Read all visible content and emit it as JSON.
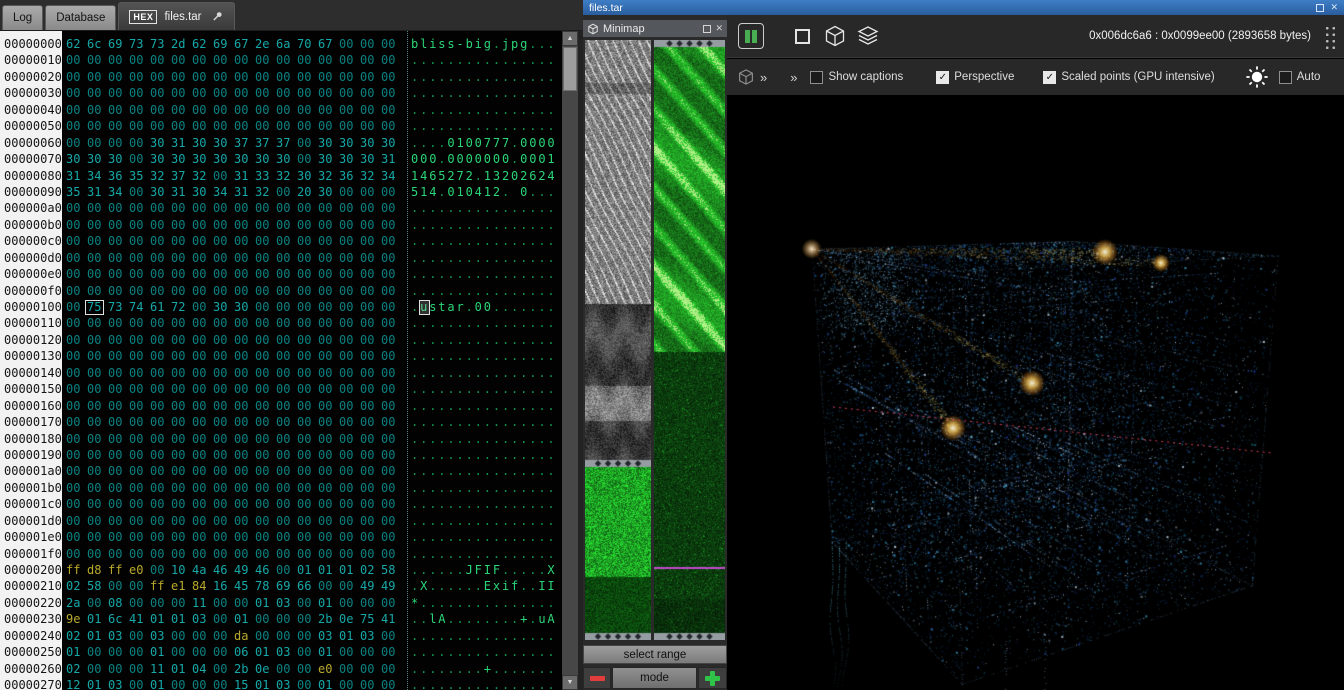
{
  "glyphs": {
    "up": "▲",
    "down": "▼",
    "close": "✕",
    "chevron": "»",
    "check": "✓"
  },
  "colors": {
    "titlebar_blue": "#316fb4",
    "hex_zero": "#0c8282",
    "hex_low": "#17a8a8",
    "hex_high": "#b9a92c",
    "ascii_printable": "#2bd677",
    "ascii_dim": "#0f9b52",
    "minimap_green": "#2fbf3f",
    "minimap_magenta": "#cd4bd7",
    "streak_orange": "#ffb347",
    "points_blue": "#3a7fd0",
    "accent_red": "#e23c3c",
    "accent_green": "#2fc34a"
  },
  "tabs": {
    "items": [
      {
        "label": "Log",
        "active": false
      },
      {
        "label": "Database",
        "active": false
      },
      {
        "label": "files.tar",
        "badge": "HEX",
        "active": true,
        "pinned": true
      }
    ]
  },
  "hex": {
    "cursor": {
      "row": 16,
      "col": 1
    },
    "rows": [
      {
        "addr": "00000000",
        "bytes": "62 6c 69 73 73 2d 62 69 67 2e 6a 70 67 00 00 00",
        "ascii": "bliss-big.jpg..."
      },
      {
        "addr": "00000010",
        "bytes": "00 00 00 00 00 00 00 00 00 00 00 00 00 00 00 00",
        "ascii": "................"
      },
      {
        "addr": "00000020",
        "bytes": "00 00 00 00 00 00 00 00 00 00 00 00 00 00 00 00",
        "ascii": "................"
      },
      {
        "addr": "00000030",
        "bytes": "00 00 00 00 00 00 00 00 00 00 00 00 00 00 00 00",
        "ascii": "................"
      },
      {
        "addr": "00000040",
        "bytes": "00 00 00 00 00 00 00 00 00 00 00 00 00 00 00 00",
        "ascii": "................"
      },
      {
        "addr": "00000050",
        "bytes": "00 00 00 00 00 00 00 00 00 00 00 00 00 00 00 00",
        "ascii": "................"
      },
      {
        "addr": "00000060",
        "bytes": "00 00 00 00 30 31 30 30 37 37 37 00 30 30 30 30",
        "ascii": "....0100777.0000"
      },
      {
        "addr": "00000070",
        "bytes": "30 30 30 00 30 30 30 30 30 30 30 00 30 30 30 31",
        "ascii": "000.0000000.0001"
      },
      {
        "addr": "00000080",
        "bytes": "31 34 36 35 32 37 32 00 31 33 32 30 32 36 32 34",
        "ascii": "1465272.13202624"
      },
      {
        "addr": "00000090",
        "bytes": "35 31 34 00 30 31 30 34 31 32 00 20 30 00 00 00",
        "ascii": "514.010412. 0..."
      },
      {
        "addr": "000000a0",
        "bytes": "00 00 00 00 00 00 00 00 00 00 00 00 00 00 00 00",
        "ascii": "................"
      },
      {
        "addr": "000000b0",
        "bytes": "00 00 00 00 00 00 00 00 00 00 00 00 00 00 00 00",
        "ascii": "................"
      },
      {
        "addr": "000000c0",
        "bytes": "00 00 00 00 00 00 00 00 00 00 00 00 00 00 00 00",
        "ascii": "................"
      },
      {
        "addr": "000000d0",
        "bytes": "00 00 00 00 00 00 00 00 00 00 00 00 00 00 00 00",
        "ascii": "................"
      },
      {
        "addr": "000000e0",
        "bytes": "00 00 00 00 00 00 00 00 00 00 00 00 00 00 00 00",
        "ascii": "................"
      },
      {
        "addr": "000000f0",
        "bytes": "00 00 00 00 00 00 00 00 00 00 00 00 00 00 00 00",
        "ascii": "................"
      },
      {
        "addr": "00000100",
        "bytes": "00 75 73 74 61 72 00 30 30 00 00 00 00 00 00 00",
        "ascii": ".ustar.00......."
      },
      {
        "addr": "00000110",
        "bytes": "00 00 00 00 00 00 00 00 00 00 00 00 00 00 00 00",
        "ascii": "................"
      },
      {
        "addr": "00000120",
        "bytes": "00 00 00 00 00 00 00 00 00 00 00 00 00 00 00 00",
        "ascii": "................"
      },
      {
        "addr": "00000130",
        "bytes": "00 00 00 00 00 00 00 00 00 00 00 00 00 00 00 00",
        "ascii": "................"
      },
      {
        "addr": "00000140",
        "bytes": "00 00 00 00 00 00 00 00 00 00 00 00 00 00 00 00",
        "ascii": "................"
      },
      {
        "addr": "00000150",
        "bytes": "00 00 00 00 00 00 00 00 00 00 00 00 00 00 00 00",
        "ascii": "................"
      },
      {
        "addr": "00000160",
        "bytes": "00 00 00 00 00 00 00 00 00 00 00 00 00 00 00 00",
        "ascii": "................"
      },
      {
        "addr": "00000170",
        "bytes": "00 00 00 00 00 00 00 00 00 00 00 00 00 00 00 00",
        "ascii": "................"
      },
      {
        "addr": "00000180",
        "bytes": "00 00 00 00 00 00 00 00 00 00 00 00 00 00 00 00",
        "ascii": "................"
      },
      {
        "addr": "00000190",
        "bytes": "00 00 00 00 00 00 00 00 00 00 00 00 00 00 00 00",
        "ascii": "................"
      },
      {
        "addr": "000001a0",
        "bytes": "00 00 00 00 00 00 00 00 00 00 00 00 00 00 00 00",
        "ascii": "................"
      },
      {
        "addr": "000001b0",
        "bytes": "00 00 00 00 00 00 00 00 00 00 00 00 00 00 00 00",
        "ascii": "................"
      },
      {
        "addr": "000001c0",
        "bytes": "00 00 00 00 00 00 00 00 00 00 00 00 00 00 00 00",
        "ascii": "................"
      },
      {
        "addr": "000001d0",
        "bytes": "00 00 00 00 00 00 00 00 00 00 00 00 00 00 00 00",
        "ascii": "................"
      },
      {
        "addr": "000001e0",
        "bytes": "00 00 00 00 00 00 00 00 00 00 00 00 00 00 00 00",
        "ascii": "................"
      },
      {
        "addr": "000001f0",
        "bytes": "00 00 00 00 00 00 00 00 00 00 00 00 00 00 00 00",
        "ascii": "................"
      },
      {
        "addr": "00000200",
        "bytes": "ff d8 ff e0 00 10 4a 46 49 46 00 01 01 01 02 58",
        "ascii": "......JFIF.....X"
      },
      {
        "addr": "00000210",
        "bytes": "02 58 00 00 ff e1 84 16 45 78 69 66 00 00 49 49",
        "ascii": ".X......Exif..II"
      },
      {
        "addr": "00000220",
        "bytes": "2a 00 08 00 00 00 11 00 00 01 03 00 01 00 00 00",
        "ascii": "*..............."
      },
      {
        "addr": "00000230",
        "bytes": "9e 01 6c 41 01 01 03 00 01 00 00 00 2b 0e 75 41",
        "ascii": "..lA........+.uA"
      },
      {
        "addr": "00000240",
        "bytes": "02 01 03 00 03 00 00 00 da 00 00 00 03 01 03 00",
        "ascii": "................"
      },
      {
        "addr": "00000250",
        "bytes": "01 00 00 00 01 00 00 00 06 01 03 00 01 00 00 00",
        "ascii": "................"
      },
      {
        "addr": "00000260",
        "bytes": "02 00 00 00 11 01 04 00 2b 0e 00 00 e0 00 00 00",
        "ascii": "........+......."
      },
      {
        "addr": "00000270",
        "bytes": "12 01 03 00 01 00 00 00 15 01 03 00 01 00 00 00",
        "ascii": "................"
      }
    ]
  },
  "minimap": {
    "title": "Minimap",
    "select_range_label": "select range",
    "mode_label": "mode"
  },
  "viz": {
    "title": "files.tar",
    "selection_info": "0x006dc6a6 : 0x0099ee00 (2893658 bytes)",
    "toolbar1_icons": [
      "node-columns-icon",
      "flat-view-icon",
      "cube-view-icon",
      "layers-view-icon",
      "grip-handle-icon"
    ],
    "toolbar2": {
      "checkboxes": [
        {
          "label": "Show captions",
          "checked": false
        },
        {
          "label": "Perspective",
          "checked": true
        },
        {
          "label": "Scaled points (GPU intensive)",
          "checked": true
        },
        {
          "label": "Auto",
          "checked": false
        }
      ]
    }
  }
}
